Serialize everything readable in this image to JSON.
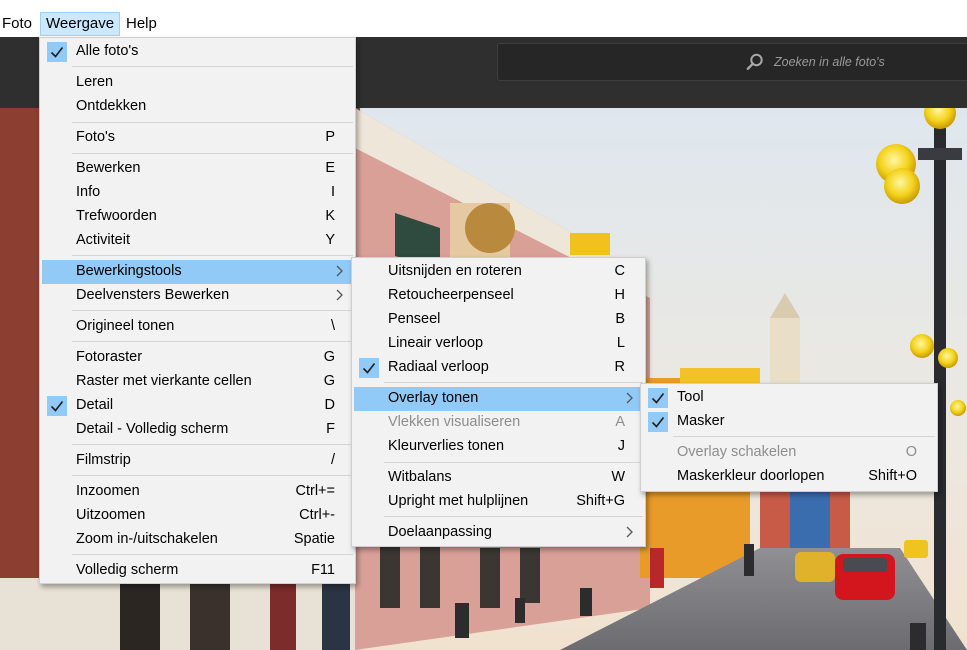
{
  "menubar": {
    "items": [
      "Foto",
      "Weergave",
      "Help"
    ]
  },
  "search": {
    "placeholder": "Zoeken in alle foto's"
  },
  "weergave_menu": {
    "items": [
      {
        "label": "Alle foto's",
        "shortcut": "",
        "checked": true
      },
      {
        "label": "Leren",
        "shortcut": ""
      },
      {
        "label": "Ontdekken",
        "shortcut": ""
      },
      {
        "label": "Foto's",
        "shortcut": "P"
      },
      {
        "label": "Bewerken",
        "shortcut": "E"
      },
      {
        "label": "Info",
        "shortcut": "I"
      },
      {
        "label": "Trefwoorden",
        "shortcut": "K"
      },
      {
        "label": "Activiteit",
        "shortcut": "Y"
      },
      {
        "label": "Bewerkingstools",
        "shortcut": "",
        "submenu": true,
        "highlighted": true
      },
      {
        "label": "Deelvensters Bewerken",
        "shortcut": "",
        "submenu": true
      },
      {
        "label": "Origineel tonen",
        "shortcut": "\\"
      },
      {
        "label": "Fotoraster",
        "shortcut": "G"
      },
      {
        "label": "Raster met vierkante cellen",
        "shortcut": "G"
      },
      {
        "label": "Detail",
        "shortcut": "D",
        "checked": true
      },
      {
        "label": "Detail - Volledig scherm",
        "shortcut": "F"
      },
      {
        "label": "Filmstrip",
        "shortcut": "/"
      },
      {
        "label": "Inzoomen",
        "shortcut": "Ctrl+="
      },
      {
        "label": "Uitzoomen",
        "shortcut": "Ctrl+-"
      },
      {
        "label": "Zoom in-/uitschakelen",
        "shortcut": "Spatie"
      },
      {
        "label": "Volledig scherm",
        "shortcut": "F11"
      }
    ]
  },
  "bewerkingstools_menu": {
    "items": [
      {
        "label": "Uitsnijden en roteren",
        "shortcut": "C"
      },
      {
        "label": "Retoucheerpenseel",
        "shortcut": "H"
      },
      {
        "label": "Penseel",
        "shortcut": "B"
      },
      {
        "label": "Lineair verloop",
        "shortcut": "L"
      },
      {
        "label": "Radiaal verloop",
        "shortcut": "R",
        "checked": true
      },
      {
        "label": "Overlay tonen",
        "shortcut": "",
        "submenu": true,
        "highlighted": true
      },
      {
        "label": "Vlekken visualiseren",
        "shortcut": "A",
        "disabled": true
      },
      {
        "label": "Kleurverlies tonen",
        "shortcut": "J"
      },
      {
        "label": "Witbalans",
        "shortcut": "W"
      },
      {
        "label": "Upright met hulplijnen",
        "shortcut": "Shift+G"
      },
      {
        "label": "Doelaanpassing",
        "shortcut": "",
        "submenu": true
      }
    ]
  },
  "overlay_menu": {
    "items": [
      {
        "label": "Tool",
        "shortcut": "",
        "checked": true
      },
      {
        "label": "Masker",
        "shortcut": "",
        "checked": true
      },
      {
        "label": "Overlay schakelen",
        "shortcut": "O",
        "disabled": true
      },
      {
        "label": "Maskerkleur doorlopen",
        "shortcut": "Shift+O"
      }
    ]
  },
  "colors": {
    "highlight": "#91c9f7",
    "menu_bg": "#f2f2f2",
    "app_dark": "#2f2f2f"
  }
}
